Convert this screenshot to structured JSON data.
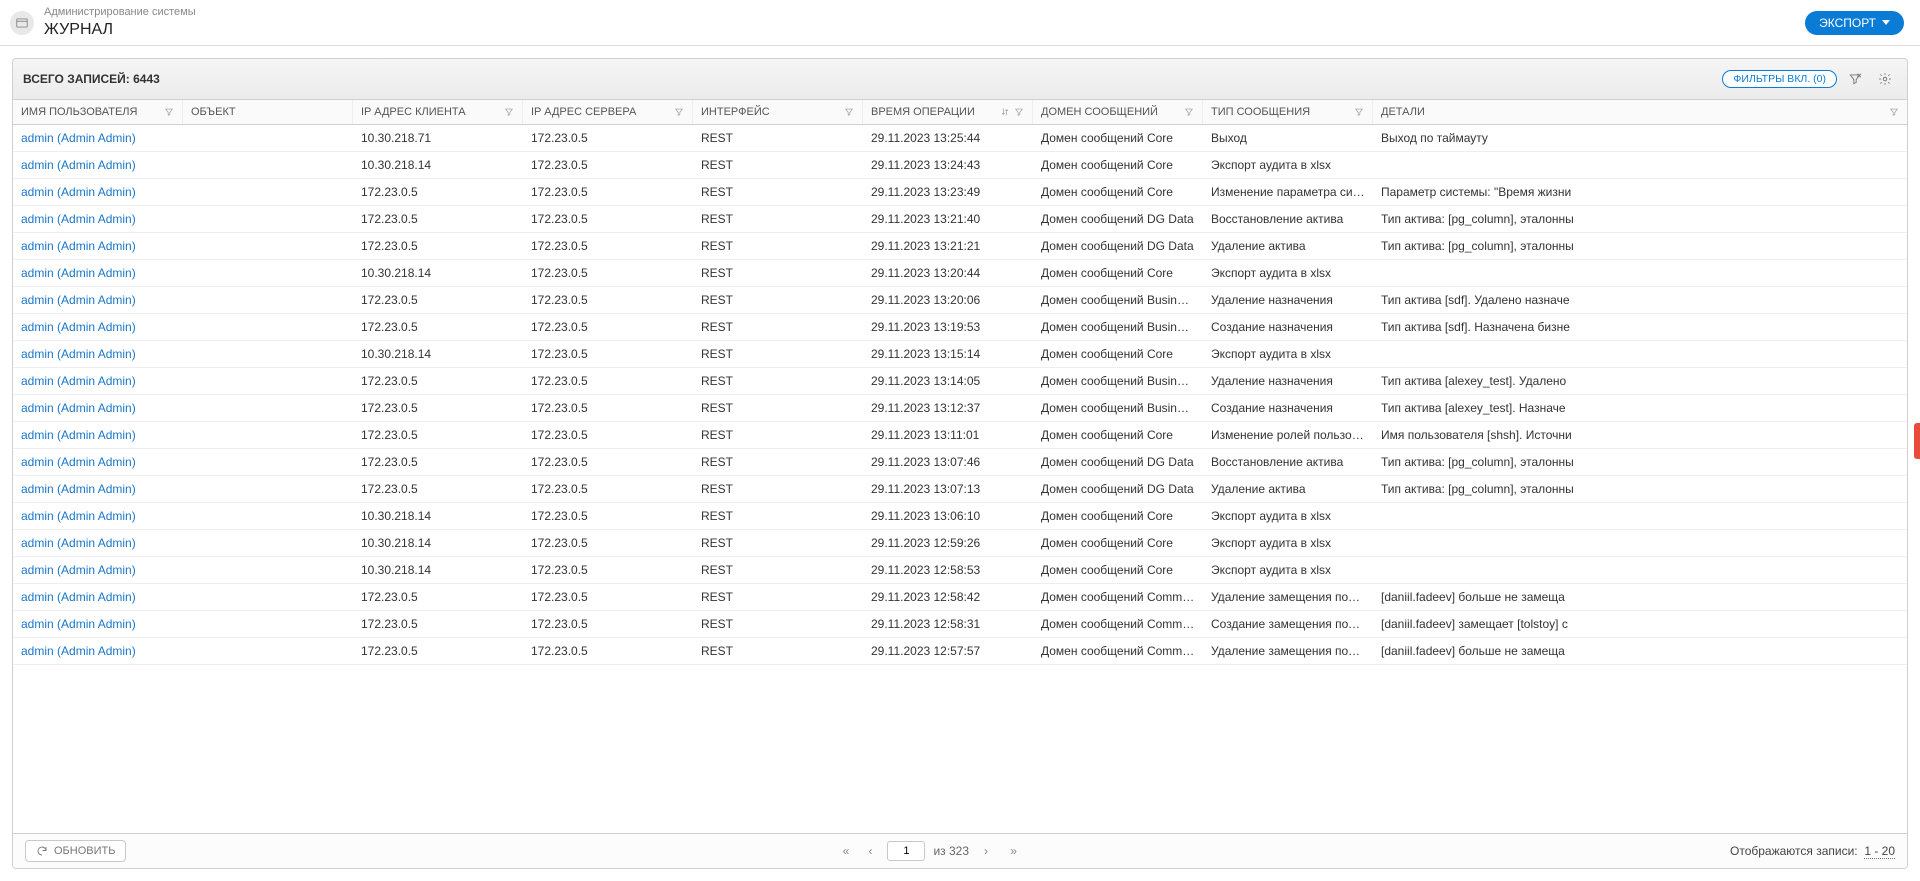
{
  "header": {
    "breadcrumb": "Администрирование системы",
    "title": "ЖУРНАЛ",
    "export_label": "ЭКСПОРТ"
  },
  "toolbar": {
    "total_label": "ВСЕГО ЗАПИСЕЙ:",
    "total_count": "6443",
    "filters_label": "ФИЛЬТРЫ ВКЛ. (0)"
  },
  "columns": {
    "user": "ИМЯ ПОЛЬЗОВАТЕЛЯ",
    "object": "ОБЪЕКТ",
    "client_ip": "IP АДРЕС КЛИЕНТА",
    "server_ip": "IP АДРЕС СЕРВЕРА",
    "interface": "ИНТЕРФЕЙС",
    "op_time": "ВРЕМЯ ОПЕРАЦИИ",
    "msg_domain": "ДОМЕН СООБЩЕНИЙ",
    "msg_type": "ТИП СООБЩЕНИЯ",
    "details": "ДЕТАЛИ"
  },
  "rows": [
    {
      "user": "admin (Admin Admin)",
      "object": "",
      "cip": "10.30.218.71",
      "sip": "172.23.0.5",
      "iface": "REST",
      "time": "29.11.2023 13:25:44",
      "domain": "Домен сообщений Core",
      "type": "Выход",
      "details": "Выход по таймауту"
    },
    {
      "user": "admin (Admin Admin)",
      "object": "",
      "cip": "10.30.218.14",
      "sip": "172.23.0.5",
      "iface": "REST",
      "time": "29.11.2023 13:24:43",
      "domain": "Домен сообщений Core",
      "type": "Экспорт аудита в xlsx",
      "details": ""
    },
    {
      "user": "admin (Admin Admin)",
      "object": "",
      "cip": "172.23.0.5",
      "sip": "172.23.0.5",
      "iface": "REST",
      "time": "29.11.2023 13:23:49",
      "domain": "Домен сообщений Core",
      "type": "Изменение параметра системы",
      "details": "Параметр системы: \"Время жизни"
    },
    {
      "user": "admin (Admin Admin)",
      "object": "",
      "cip": "172.23.0.5",
      "sip": "172.23.0.5",
      "iface": "REST",
      "time": "29.11.2023 13:21:40",
      "domain": "Домен сообщений DG Data",
      "type": "Восстановление актива",
      "details": "Тип актива: [pg_column], эталонны"
    },
    {
      "user": "admin (Admin Admin)",
      "object": "",
      "cip": "172.23.0.5",
      "sip": "172.23.0.5",
      "iface": "REST",
      "time": "29.11.2023 13:21:21",
      "domain": "Домен сообщений DG Data",
      "type": "Удаление актива",
      "details": "Тип актива: [pg_column], эталонны"
    },
    {
      "user": "admin (Admin Admin)",
      "object": "",
      "cip": "10.30.218.14",
      "sip": "172.23.0.5",
      "iface": "REST",
      "time": "29.11.2023 13:20:44",
      "domain": "Домен сообщений Core",
      "type": "Экспорт аудита в xlsx",
      "details": ""
    },
    {
      "user": "admin (Admin Admin)",
      "object": "",
      "cip": "172.23.0.5",
      "sip": "172.23.0.5",
      "iface": "REST",
      "time": "29.11.2023 13:20:06",
      "domain": "Домен сообщений Business Roles",
      "type": "Удаление назначения",
      "details": "Тип актива [sdf]. Удалено назначе"
    },
    {
      "user": "admin (Admin Admin)",
      "object": "",
      "cip": "172.23.0.5",
      "sip": "172.23.0.5",
      "iface": "REST",
      "time": "29.11.2023 13:19:53",
      "domain": "Домен сообщений Business Roles",
      "type": "Создание назначения",
      "details": "Тип актива [sdf]. Назначена бизне"
    },
    {
      "user": "admin (Admin Admin)",
      "object": "",
      "cip": "10.30.218.14",
      "sip": "172.23.0.5",
      "iface": "REST",
      "time": "29.11.2023 13:15:14",
      "domain": "Домен сообщений Core",
      "type": "Экспорт аудита в xlsx",
      "details": ""
    },
    {
      "user": "admin (Admin Admin)",
      "object": "",
      "cip": "172.23.0.5",
      "sip": "172.23.0.5",
      "iface": "REST",
      "time": "29.11.2023 13:14:05",
      "domain": "Домен сообщений Business Roles",
      "type": "Удаление назначения",
      "details": "Тип актива [alexey_test]. Удалено"
    },
    {
      "user": "admin (Admin Admin)",
      "object": "",
      "cip": "172.23.0.5",
      "sip": "172.23.0.5",
      "iface": "REST",
      "time": "29.11.2023 13:12:37",
      "domain": "Домен сообщений Business Roles",
      "type": "Создание назначения",
      "details": "Тип актива [alexey_test]. Назначе"
    },
    {
      "user": "admin (Admin Admin)",
      "object": "",
      "cip": "172.23.0.5",
      "sip": "172.23.0.5",
      "iface": "REST",
      "time": "29.11.2023 13:11:01",
      "domain": "Домен сообщений Core",
      "type": "Изменение ролей пользователя",
      "details": "Имя пользователя [shsh]. Источни"
    },
    {
      "user": "admin (Admin Admin)",
      "object": "",
      "cip": "172.23.0.5",
      "sip": "172.23.0.5",
      "iface": "REST",
      "time": "29.11.2023 13:07:46",
      "domain": "Домен сообщений DG Data",
      "type": "Восстановление актива",
      "details": "Тип актива: [pg_column], эталонны"
    },
    {
      "user": "admin (Admin Admin)",
      "object": "",
      "cip": "172.23.0.5",
      "sip": "172.23.0.5",
      "iface": "REST",
      "time": "29.11.2023 13:07:13",
      "domain": "Домен сообщений DG Data",
      "type": "Удаление актива",
      "details": "Тип актива: [pg_column], эталонны"
    },
    {
      "user": "admin (Admin Admin)",
      "object": "",
      "cip": "10.30.218.14",
      "sip": "172.23.0.5",
      "iface": "REST",
      "time": "29.11.2023 13:06:10",
      "domain": "Домен сообщений Core",
      "type": "Экспорт аудита в xlsx",
      "details": ""
    },
    {
      "user": "admin (Admin Admin)",
      "object": "",
      "cip": "10.30.218.14",
      "sip": "172.23.0.5",
      "iface": "REST",
      "time": "29.11.2023 12:59:26",
      "domain": "Домен сообщений Core",
      "type": "Экспорт аудита в xlsx",
      "details": ""
    },
    {
      "user": "admin (Admin Admin)",
      "object": "",
      "cip": "10.30.218.14",
      "sip": "172.23.0.5",
      "iface": "REST",
      "time": "29.11.2023 12:58:53",
      "domain": "Домен сообщений Core",
      "type": "Экспорт аудита в xlsx",
      "details": ""
    },
    {
      "user": "admin (Admin Admin)",
      "object": "",
      "cip": "172.23.0.5",
      "sip": "172.23.0.5",
      "iface": "REST",
      "time": "29.11.2023 12:58:42",
      "domain": "Домен сообщений Commercial Co",
      "type": "Удаление замещения пользовате",
      "details": "[daniil.fadeev] больше не замеща"
    },
    {
      "user": "admin (Admin Admin)",
      "object": "",
      "cip": "172.23.0.5",
      "sip": "172.23.0.5",
      "iface": "REST",
      "time": "29.11.2023 12:58:31",
      "domain": "Домен сообщений Commercial Co",
      "type": "Создание замещения пользовате",
      "details": "[daniil.fadeev] замещает [tolstoy] с"
    },
    {
      "user": "admin (Admin Admin)",
      "object": "",
      "cip": "172.23.0.5",
      "sip": "172.23.0.5",
      "iface": "REST",
      "time": "29.11.2023 12:57:57",
      "domain": "Домен сообщений Commercial Co",
      "type": "Удаление замещения пользовате",
      "details": "[daniil.fadeev] больше не замеща"
    }
  ],
  "footer": {
    "refresh_label": "ОБНОВИТЬ",
    "page_value": "1",
    "page_of_prefix": "из",
    "pages_total": "323",
    "shown_prefix": "Отображаются записи:",
    "shown_range": "1 - 20"
  }
}
